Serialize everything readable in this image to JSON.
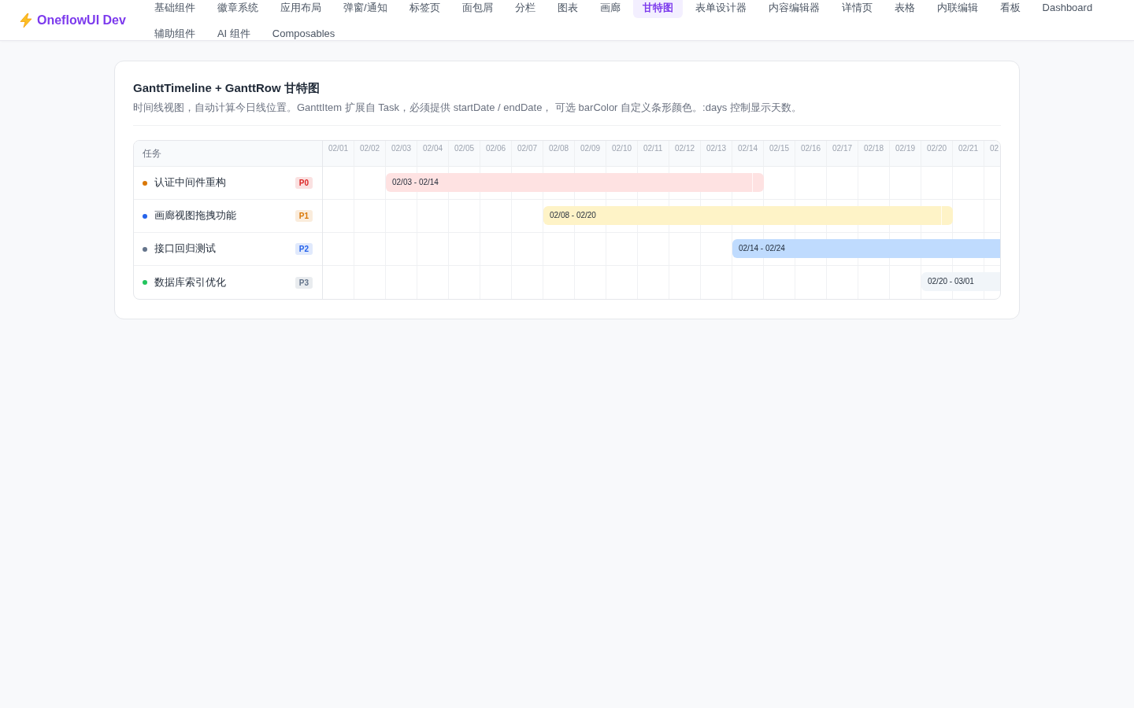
{
  "header": {
    "app_name": "OneflowUI Dev",
    "nav": [
      {
        "label": "基础组件",
        "selected": false
      },
      {
        "label": "徽章系统",
        "selected": false
      },
      {
        "label": "应用布局",
        "selected": false
      },
      {
        "label": "弹窗/通知",
        "selected": false
      },
      {
        "label": "标签页",
        "selected": false
      },
      {
        "label": "面包屑",
        "selected": false
      },
      {
        "label": "分栏",
        "selected": false
      },
      {
        "label": "图表",
        "selected": false
      },
      {
        "label": "画廊",
        "selected": false
      },
      {
        "label": "甘特图",
        "selected": true
      },
      {
        "label": "表单设计器",
        "selected": false
      },
      {
        "label": "内容编辑器",
        "selected": false
      },
      {
        "label": "详情页",
        "selected": false
      },
      {
        "label": "表格",
        "selected": false
      },
      {
        "label": "内联编辑",
        "selected": false
      },
      {
        "label": "看板",
        "selected": false
      },
      {
        "label": "Dashboard",
        "selected": false
      },
      {
        "label": "辅助组件",
        "selected": false
      },
      {
        "label": "AI 组件",
        "selected": false
      },
      {
        "label": "Composables",
        "selected": false
      }
    ]
  },
  "card": {
    "title": "GanttTimeline + GanttRow 甘特图",
    "description": "时间线视图，自动计算今日线位置。GanttItem 扩展自 Task，必须提供 startDate / endDate， 可选 barColor 自定义条形颜色。:days 控制显示天数。"
  },
  "gantt": {
    "task_column": "任务",
    "days": [
      "02/01",
      "02/02",
      "02/03",
      "02/04",
      "02/05",
      "02/06",
      "02/07",
      "02/08",
      "02/09",
      "02/10",
      "02/11",
      "02/12",
      "02/13",
      "02/14",
      "02/15",
      "02/16",
      "02/17",
      "02/18",
      "02/19",
      "02/20",
      "02/21",
      "02"
    ],
    "tasks": [
      {
        "name": "认证中间件重构",
        "color": "#d97706",
        "priority": {
          "label": "P0",
          "color": "#dc2626"
        },
        "bar": {
          "label": "02/03 - 02/14",
          "color": "#fee2e2"
        }
      },
      {
        "name": "画廊视图拖拽功能",
        "color": "#2563eb",
        "priority": {
          "label": "P1",
          "color": "#d97706"
        },
        "bar": {
          "label": "02/08 - 02/20",
          "color": "#fef3c7"
        }
      },
      {
        "name": "接口回归测试",
        "color": "#64748b",
        "priority": {
          "label": "P2",
          "color": "#2563eb"
        },
        "bar": {
          "label": "02/14 - 02/24",
          "color": "#bfdbfe"
        }
      },
      {
        "name": "数据库索引优化",
        "color": "#22c55e",
        "priority": {
          "label": "P3",
          "color": "#64748b"
        },
        "bar": {
          "label": "02/20 - 03/01",
          "color": "#f1f5f9"
        }
      }
    ]
  }
}
